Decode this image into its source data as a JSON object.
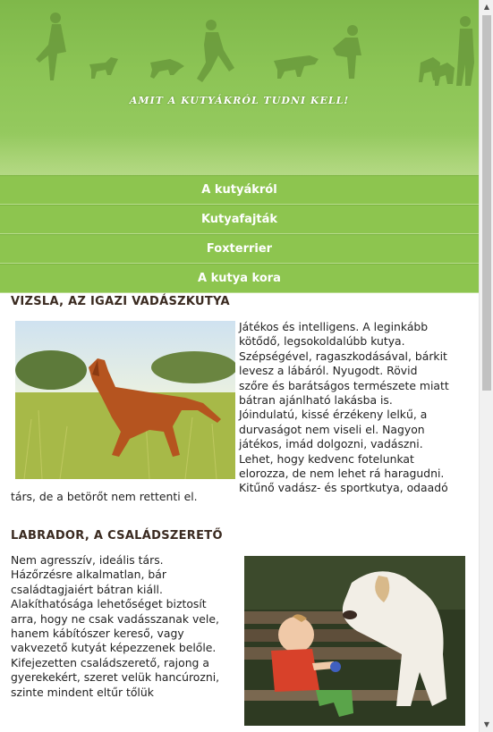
{
  "header": {
    "tagline": "AMIT A KUTYÁKRÓL TUDNI KELL!"
  },
  "nav": {
    "items": [
      {
        "label": "A kutyákról"
      },
      {
        "label": "Kutyafajták"
      },
      {
        "label": "Foxterrier"
      },
      {
        "label": "A kutya kora"
      }
    ]
  },
  "articles": {
    "vizsla": {
      "title": "VIZSLA, AZ IGAZI VADÁSZKUTYA",
      "text_lines": [
        "Játékos és intelligens. A leginkább",
        "kötődő, legsokoldalúbb kutya.",
        "Szépségével, ragaszkodásával, bárkit",
        "levesz a lábáról. Nyugodt. Rövid",
        "szőre és barátságos természete miatt",
        "bátran ajánlható lakásba is.",
        "Jóindulatú, kissé érzékeny lelkű, a",
        "durvaságot nem viseli el. Nagyon",
        "játékos, imád dolgozni, vadászni.",
        "Lehet, hogy kedvenc fotelunkat",
        "elorozza, de nem lehet rá haragudni.",
        "Kitűnő vadász- és sportkutya, odaadó"
      ],
      "text_tail": "társ, de a betörőt nem rettenti el."
    },
    "labrador": {
      "title": "LABRADOR, A CSALÁDSZERETŐ",
      "text_lines": [
        "Nem agresszív, ideális társ.",
        "Házőrzésre alkalmatlan, bár",
        "családtagjaiért bátran kiáll.",
        "Alakíthatósága lehetőséget biztosít",
        "arra, hogy ne csak vadásszanak vele,",
        "hanem kábítószer kereső, vagy",
        "vakvezető kutyát képezzenek belőle.",
        "Kifejezetten családszerető, rajong a",
        "gyerekekért, szeret velük hancúrozni,",
        "szinte mindent eltűr tőlük"
      ]
    }
  },
  "colors": {
    "nav_green": "#8dc54f",
    "header_green": "#8cc455",
    "title_brown": "#3a2a20"
  },
  "scrollbar": {
    "up_icon": "▲",
    "down_icon": "▼"
  }
}
